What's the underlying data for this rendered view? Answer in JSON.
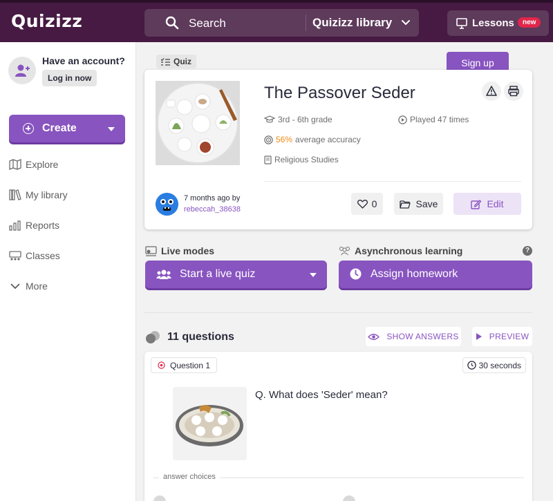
{
  "header": {
    "logo": "Quizizz",
    "search_placeholder": "Search",
    "library_select": "Quizizz library",
    "lessons_label": "Lessons",
    "lessons_badge": "new",
    "colors": {
      "bar": "#461a42",
      "field": "#5e3a5b",
      "badge": "#e2264b"
    }
  },
  "sidebar": {
    "account_prompt": "Have an account?",
    "login_label": "Log in now",
    "create_label": "Create",
    "nav": [
      {
        "label": "Explore",
        "icon": "map-icon"
      },
      {
        "label": "My library",
        "icon": "library-icon"
      },
      {
        "label": "Reports",
        "icon": "reports-icon"
      },
      {
        "label": "Classes",
        "icon": "classes-icon"
      },
      {
        "label": "More",
        "icon": "chevron-down-icon"
      }
    ]
  },
  "quiz": {
    "tag": "Quiz",
    "signup_label": "Sign up",
    "title": "The Passover Seder",
    "grade": "3rd - 6th grade",
    "played": "Played 47 times",
    "accuracy_value": "56%",
    "accuracy_text": "average accuracy",
    "subject": "Religious Studies",
    "author_time": "7 months ago by",
    "author_name": "rebeccah_38638",
    "likes": "0",
    "save_label": "Save",
    "edit_label": "Edit"
  },
  "modes": {
    "live_label": "Live modes",
    "async_label": "Asynchronous learning",
    "help": "?",
    "start_live": "Start a live quiz",
    "assign_hw": "Assign homework"
  },
  "questions": {
    "count_label": "11 questions",
    "show_answers": "SHOW ANSWERS",
    "preview": "PREVIEW",
    "first": {
      "number_label": "Question 1",
      "time_label": "30 seconds",
      "text": "Q. What does 'Seder' mean?",
      "answer_choices_label": "answer choices"
    }
  },
  "colors": {
    "accent": "#8854c0",
    "accent_dark": "#6c3ba1",
    "accuracy": "#ef8a16"
  }
}
